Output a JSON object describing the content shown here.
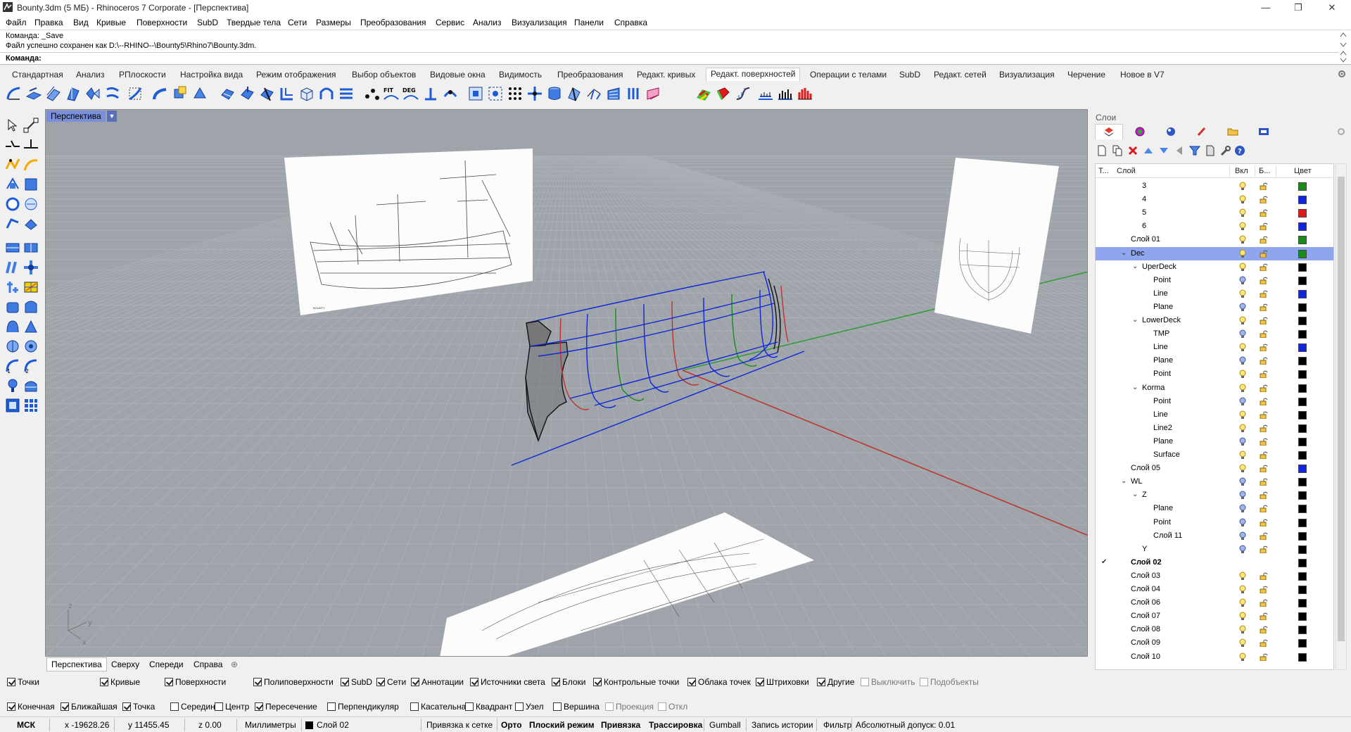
{
  "window": {
    "title": "Bounty.3dm (5 МБ) - Rhinoceros 7 Corporate - [Перспектива]"
  },
  "menu": [
    "Файл",
    "Правка",
    "Вид",
    "Кривые",
    "Поверхности",
    "SubD",
    "Твердые тела",
    "Сети",
    "Размеры",
    "Преобразования",
    "Сервис",
    "Анализ",
    "Визуализация",
    "Панели",
    "Справка"
  ],
  "command": {
    "history1": "Команда: _Save",
    "history2": "Файл успешно сохранен как D:\\--RHINO--\\Bounty5\\Rhino7\\Bounty.3dm.",
    "prompt": "Команда:"
  },
  "toolbar_tabs": [
    "Стандартная",
    "Анализ",
    "РПлоскости",
    "Настройка вида",
    "Режим отображения",
    "Выбор объектов",
    "Видовые окна",
    "Видимость",
    "Преобразования",
    "Редакт. кривых",
    "Редакт. поверхностей",
    "Операции с телами",
    "SubD",
    "Редакт. сетей",
    "Визуализация",
    "Черчение",
    "Новое в V7"
  ],
  "active_toolbar_tab": "Редакт. поверхностей",
  "viewport": {
    "title": "Перспектива",
    "axis_x": "x",
    "axis_y": "y",
    "axis_z": "z"
  },
  "viewport_tabs": [
    "Перспектива",
    "Сверху",
    "Спереди",
    "Справа"
  ],
  "layers_panel": {
    "title": "Слои",
    "headers": {
      "t": "Т...",
      "layer": "Слой",
      "on": "Вкл",
      "lock": "Б...",
      "color": "Цвет"
    },
    "rows": [
      {
        "name": "3",
        "level": 3,
        "color": "#1a8a1a",
        "bulb": "on"
      },
      {
        "name": "4",
        "level": 3,
        "color": "#1024e0",
        "bulb": "on"
      },
      {
        "name": "5",
        "level": 3,
        "color": "#e01a1a",
        "bulb": "on"
      },
      {
        "name": "6",
        "level": 3,
        "color": "#1024e0",
        "bulb": "on"
      },
      {
        "name": "Слой 01",
        "level": 2,
        "color": "#1a8a1a",
        "bulb": "on"
      },
      {
        "name": "Dec",
        "level": 2,
        "color": "#1a8a1a",
        "bulb": "on",
        "expanded": true,
        "selected": true
      },
      {
        "name": "UperDeck",
        "level": 3,
        "color": "#000000",
        "bulb": "on",
        "expanded": true
      },
      {
        "name": "Point",
        "level": 4,
        "color": "#000000",
        "bulb": "off"
      },
      {
        "name": "Line",
        "level": 4,
        "color": "#1024e0",
        "bulb": "on"
      },
      {
        "name": "Plane",
        "level": 4,
        "color": "#000000",
        "bulb": "off"
      },
      {
        "name": "LowerDeck",
        "level": 3,
        "color": "#000000",
        "bulb": "on",
        "expanded": true
      },
      {
        "name": "TMP",
        "level": 4,
        "color": "#000000",
        "bulb": "off"
      },
      {
        "name": "Line",
        "level": 4,
        "color": "#1024e0",
        "bulb": "on"
      },
      {
        "name": "Plane",
        "level": 4,
        "color": "#000000",
        "bulb": "off"
      },
      {
        "name": "Point",
        "level": 4,
        "color": "#000000",
        "bulb": "on"
      },
      {
        "name": "Korma",
        "level": 3,
        "color": "#000000",
        "bulb": "on",
        "expanded": true
      },
      {
        "name": "Point",
        "level": 4,
        "color": "#000000",
        "bulb": "off"
      },
      {
        "name": "Line",
        "level": 4,
        "color": "#000000",
        "bulb": "on"
      },
      {
        "name": "Line2",
        "level": 4,
        "color": "#000000",
        "bulb": "on"
      },
      {
        "name": "Plane",
        "level": 4,
        "color": "#000000",
        "bulb": "off"
      },
      {
        "name": "Surface",
        "level": 4,
        "color": "#000000",
        "bulb": "on"
      },
      {
        "name": "Слой 05",
        "level": 2,
        "color": "#1024e0",
        "bulb": "on"
      },
      {
        "name": "WL",
        "level": 2,
        "color": "#000000",
        "bulb": "off",
        "expanded": true
      },
      {
        "name": "Z",
        "level": 3,
        "color": "#000000",
        "bulb": "off",
        "expanded": true
      },
      {
        "name": "Plane",
        "level": 4,
        "color": "#000000",
        "bulb": "off"
      },
      {
        "name": "Point",
        "level": 4,
        "color": "#000000",
        "bulb": "off"
      },
      {
        "name": "Слой 11",
        "level": 4,
        "color": "#000000",
        "bulb": "off"
      },
      {
        "name": "Y",
        "level": 3,
        "color": "#000000",
        "bulb": "off"
      },
      {
        "name": "Слой 02",
        "level": 2,
        "color": "#000000",
        "bulb": "none",
        "current": true
      },
      {
        "name": "Слой 03",
        "level": 2,
        "color": "#000000",
        "bulb": "on"
      },
      {
        "name": "Слой 04",
        "level": 2,
        "color": "#000000",
        "bulb": "on"
      },
      {
        "name": "Слой 06",
        "level": 2,
        "color": "#000000",
        "bulb": "on"
      },
      {
        "name": "Слой 07",
        "level": 2,
        "color": "#000000",
        "bulb": "on"
      },
      {
        "name": "Слой 08",
        "level": 2,
        "color": "#000000",
        "bulb": "on"
      },
      {
        "name": "Слой 09",
        "level": 2,
        "color": "#000000",
        "bulb": "on"
      },
      {
        "name": "Слой 10",
        "level": 2,
        "color": "#000000",
        "bulb": "on"
      }
    ]
  },
  "select_filters": [
    {
      "label": "Точки",
      "checked": true
    },
    {
      "label": "Кривые",
      "checked": true
    },
    {
      "label": "Поверхности",
      "checked": true
    },
    {
      "label": "Полиповерхности",
      "checked": true
    },
    {
      "label": "SubD",
      "checked": true
    },
    {
      "label": "Сети",
      "checked": true
    },
    {
      "label": "Аннотации",
      "checked": true
    },
    {
      "label": "Источники света",
      "checked": true
    },
    {
      "label": "Блоки",
      "checked": true
    },
    {
      "label": "Контрольные точки",
      "checked": true
    },
    {
      "label": "Облака точек",
      "checked": true
    },
    {
      "label": "Штриховки",
      "checked": true
    },
    {
      "label": "Другие",
      "checked": true
    },
    {
      "label": "Выключить",
      "checked": false,
      "disabled": true
    },
    {
      "label": "Подобъекты",
      "checked": false,
      "disabled": true
    }
  ],
  "osnaps": [
    {
      "label": "Конечная",
      "checked": true
    },
    {
      "label": "Ближайшая",
      "checked": true
    },
    {
      "label": "Точка",
      "checked": true
    },
    {
      "label": "Середина",
      "checked": false
    },
    {
      "label": "Центр",
      "checked": false
    },
    {
      "label": "Пересечение",
      "checked": true
    },
    {
      "label": "Перпендикуляр",
      "checked": false
    },
    {
      "label": "Касательная",
      "checked": false
    },
    {
      "label": "Квадрант",
      "checked": false
    },
    {
      "label": "Узел",
      "checked": false
    },
    {
      "label": "Вершина",
      "checked": false
    },
    {
      "label": "Проекция",
      "checked": false,
      "disabled": true
    },
    {
      "label": "Откл",
      "checked": false,
      "disabled": true
    }
  ],
  "status": {
    "cplane": "МСК",
    "x": "x -19628.26",
    "y": "y 11455.45",
    "z": "z 0.00",
    "units": "Миллиметры",
    "layer": "Слой 02",
    "grid_snap": "Привязка к сетке",
    "ortho": "Орто",
    "planar": "Плоский режим",
    "osnap": "Привязка",
    "smarttrack": "Трассировка",
    "gumball": "Gumball",
    "history": "Запись истории",
    "filter": "Фильтр",
    "tolerance": "Абсолютный допуск: 0.01"
  }
}
